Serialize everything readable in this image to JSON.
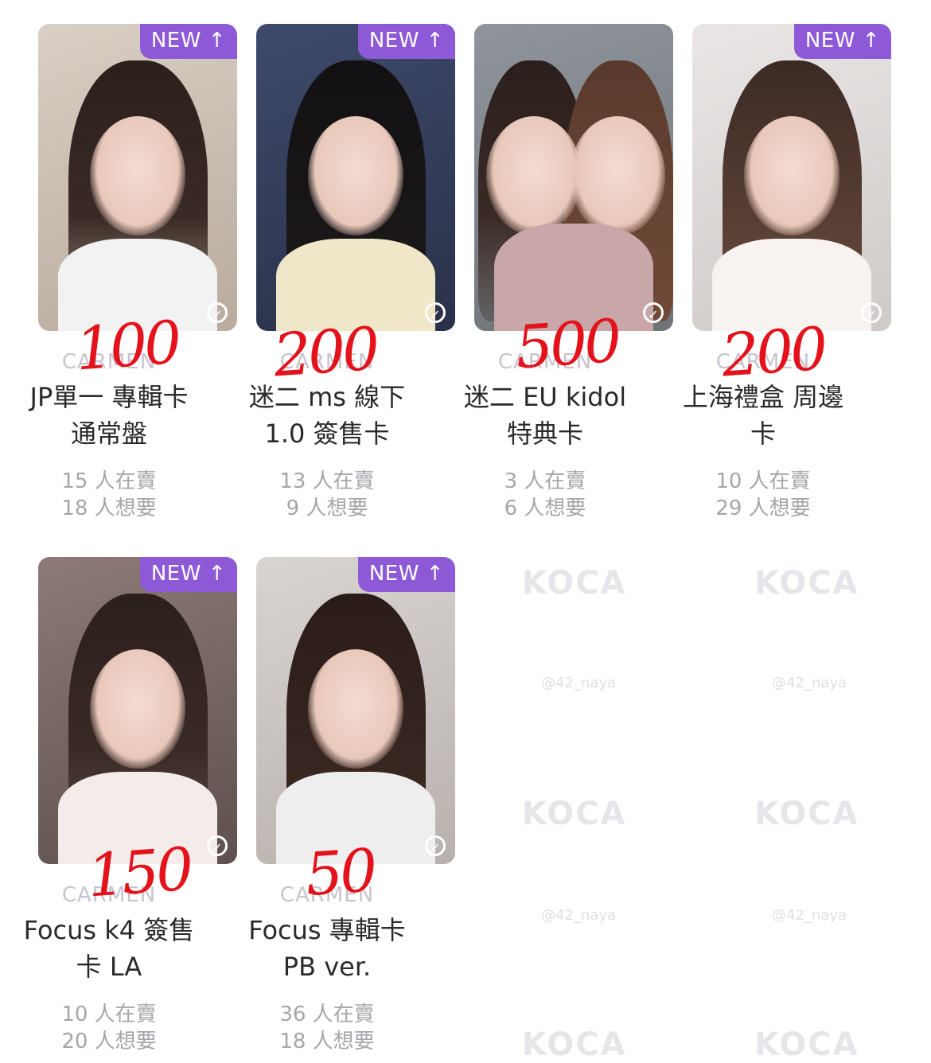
{
  "badge_label": "NEW ↑",
  "artist": "CARMEN",
  "watermark": "KOCA",
  "watermark_handle": "@42_naya",
  "cards": [
    {
      "title_line1": "JP單一 專輯卡",
      "title_line2": "通常盤",
      "selling": "15 人在賣",
      "wanting": "18 人想要",
      "handwritten_price": "100",
      "new": true
    },
    {
      "title_line1": "迷二 ms 線下",
      "title_line2": "1.0 簽售卡",
      "selling": "13 人在賣",
      "wanting": "9 人想要",
      "handwritten_price": "200",
      "new": true
    },
    {
      "title_line1": "迷二 EU kidol",
      "title_line2": "特典卡",
      "selling": "3 人在賣",
      "wanting": "6 人想要",
      "handwritten_price": "500",
      "new": false
    },
    {
      "title_line1": "上海禮盒 周邊",
      "title_line2": "卡",
      "selling": "10 人在賣",
      "wanting": "29 人想要",
      "handwritten_price": "200",
      "new": true
    },
    {
      "title_line1": "Focus k4 簽售",
      "title_line2": "卡 LA",
      "selling": "10 人在賣",
      "wanting": "20 人想要",
      "handwritten_price": "150",
      "new": true
    },
    {
      "title_line1": "Focus 專輯卡",
      "title_line2": "PB ver.",
      "selling": "36 人在賣",
      "wanting": "18 人想要",
      "handwritten_price": "50",
      "new": true
    }
  ],
  "colors": {
    "badge": "#8e59d6",
    "handwriting": "#e3121b"
  }
}
